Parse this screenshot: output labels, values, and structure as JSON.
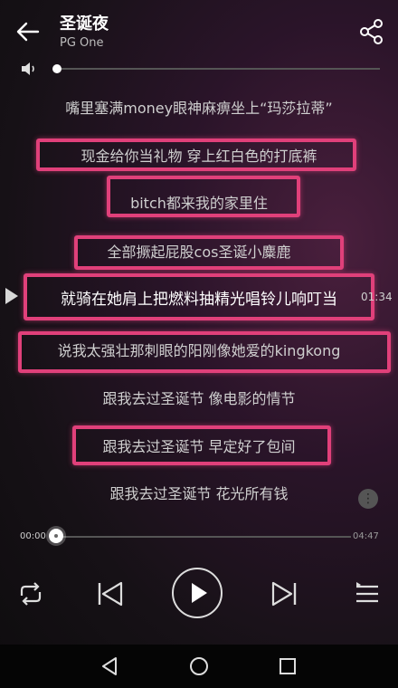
{
  "header": {
    "title": "圣诞夜",
    "artist": "PG One"
  },
  "lyrics": {
    "lines": [
      "嘴里塞满money眼神麻痹坐上“玛莎拉蒂”",
      "现金给你当礼物 穿上红白色的打底裤",
      "bitch都来我的家里住",
      "全部撅起屁股cos圣诞小麋鹿",
      "就骑在她肩上把燃料抽精光唱铃儿响叮当",
      "说我太强壮那刺眼的阳刚像她爱的kingkong",
      "跟我去过圣诞节 像电影的情节",
      "跟我去过圣诞节 早定好了包间",
      "跟我去过圣诞节 花光所有钱"
    ],
    "marker_time": "01:34",
    "highlight_color": "#e0407a"
  },
  "player": {
    "elapsed": "00:00",
    "total": "04:47",
    "progress": 0,
    "volume": 0
  },
  "icons": {
    "back": "back-arrow-icon",
    "share": "share-icon",
    "volume": "speaker-icon",
    "repeat": "repeat-icon",
    "prev": "skip-previous-icon",
    "play": "play-icon",
    "next": "skip-next-icon",
    "playlist": "playlist-icon",
    "more": "more-icon",
    "nav_back": "nav-back-icon",
    "nav_home": "nav-home-icon",
    "nav_recent": "nav-recent-icon"
  }
}
